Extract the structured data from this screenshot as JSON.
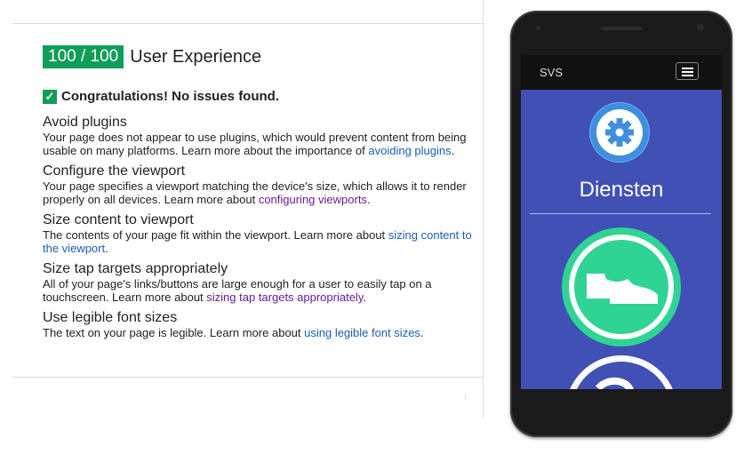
{
  "score": {
    "badge": "100 / 100",
    "title": "User Experience"
  },
  "summary": {
    "check": "✓",
    "text": "Congratulations! No issues found."
  },
  "rules": [
    {
      "title": "Avoid plugins",
      "text": "Your page does not appear to use plugins, which would prevent content from being usable on many platforms. Learn more about the importance of ",
      "link": "avoiding plugins",
      "after": "."
    },
    {
      "title": "Configure the viewport",
      "text": "Your page specifies a viewport matching the device's size, which allows it to render properly on all devices. Learn more about ",
      "link": "configuring viewports",
      "after": "."
    },
    {
      "title": "Size content to viewport",
      "text": "The contents of your page fit within the viewport. Learn more about ",
      "link": "sizing content to the viewport",
      "after": "."
    },
    {
      "title": "Size tap targets appropriately",
      "text": "All of your page's links/buttons are large enough for a user to easily tap on a touchscreen. Learn more about ",
      "link": "sizing tap targets appropriately",
      "after": "."
    },
    {
      "title": "Use legible font sizes",
      "text": "The text on your page is legible. Learn more about ",
      "link": "using legible font sizes",
      "after": "."
    }
  ],
  "phone": {
    "brand": "SVS",
    "heading": "Diensten",
    "colors": {
      "screen": "#4050b5",
      "gear": "#3f8fe0",
      "shoe": "#2fd494",
      "nav": "#111111"
    },
    "icons": [
      "menu-icon",
      "gear-icon",
      "shoe-icon"
    ]
  }
}
